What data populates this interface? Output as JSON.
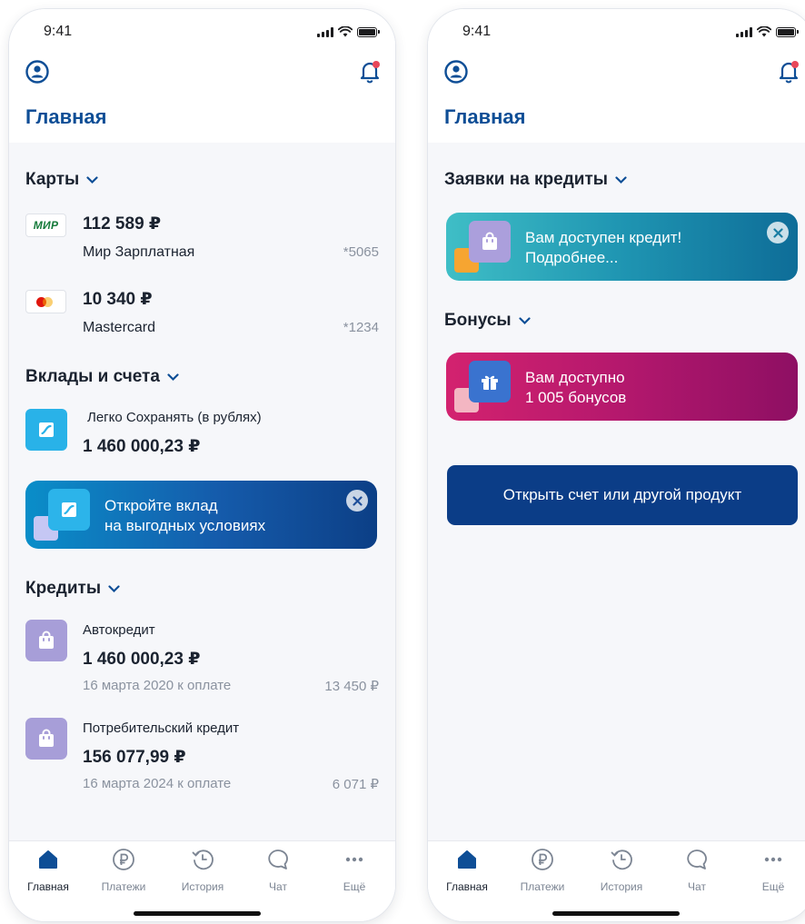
{
  "status": {
    "time": "9:41"
  },
  "header": {
    "title": "Главная"
  },
  "left": {
    "cards_section": {
      "title": "Карты",
      "items": [
        {
          "logo": "МИР",
          "amount": "112 589 ₽",
          "name": "Мир Зарплатная",
          "number": "*5065"
        },
        {
          "logo": "mastercard-logo",
          "amount": "10 340 ₽",
          "name": "Mastercard",
          "number": "*1234"
        }
      ]
    },
    "accounts_section": {
      "title": "Вклады и счета",
      "item": {
        "name": "Легко Сохранять (в рублях)",
        "amount": "1 460 000,23 ₽"
      },
      "banner": {
        "line1": "Откройте вклад",
        "line2": "на выгодных условиях"
      }
    },
    "credits_section": {
      "title": "Кредиты",
      "items": [
        {
          "name": "Автокредит",
          "amount": "1 460 000,23 ₽",
          "due": "16 марта 2020 к оплате",
          "payment": "13 450 ₽"
        },
        {
          "name": "Потребительский кредит",
          "amount": "156 077,99 ₽",
          "due": "16 марта 2024 к оплате",
          "payment": "6 071 ₽"
        }
      ]
    }
  },
  "right": {
    "applications_section": {
      "title": "Заявки на кредиты",
      "banner": {
        "line1": "Вам доступен кредит!",
        "line2": "Подробнее..."
      }
    },
    "bonus_section": {
      "title": "Бонусы",
      "banner": {
        "line1": "Вам доступно",
        "line2": "1 005 бонусов"
      }
    },
    "cta": {
      "label": "Открыть счет или другой продукт"
    }
  },
  "tabbar": {
    "items": [
      {
        "label": "Главная",
        "icon": "home-icon",
        "active": true
      },
      {
        "label": "Платежи",
        "icon": "ruble-icon"
      },
      {
        "label": "История",
        "icon": "history-icon"
      },
      {
        "label": "Чат",
        "icon": "chat-icon"
      },
      {
        "label": "Ещё",
        "icon": "more-icon"
      }
    ]
  },
  "colors": {
    "title_blue": "#0e4e96",
    "cta_blue": "#0b3d87",
    "bell_badge": "#e8475a",
    "deposit_banner": "#155bab",
    "credit_banner": "#1f95b2",
    "bonus_banner": "#b4186d"
  }
}
